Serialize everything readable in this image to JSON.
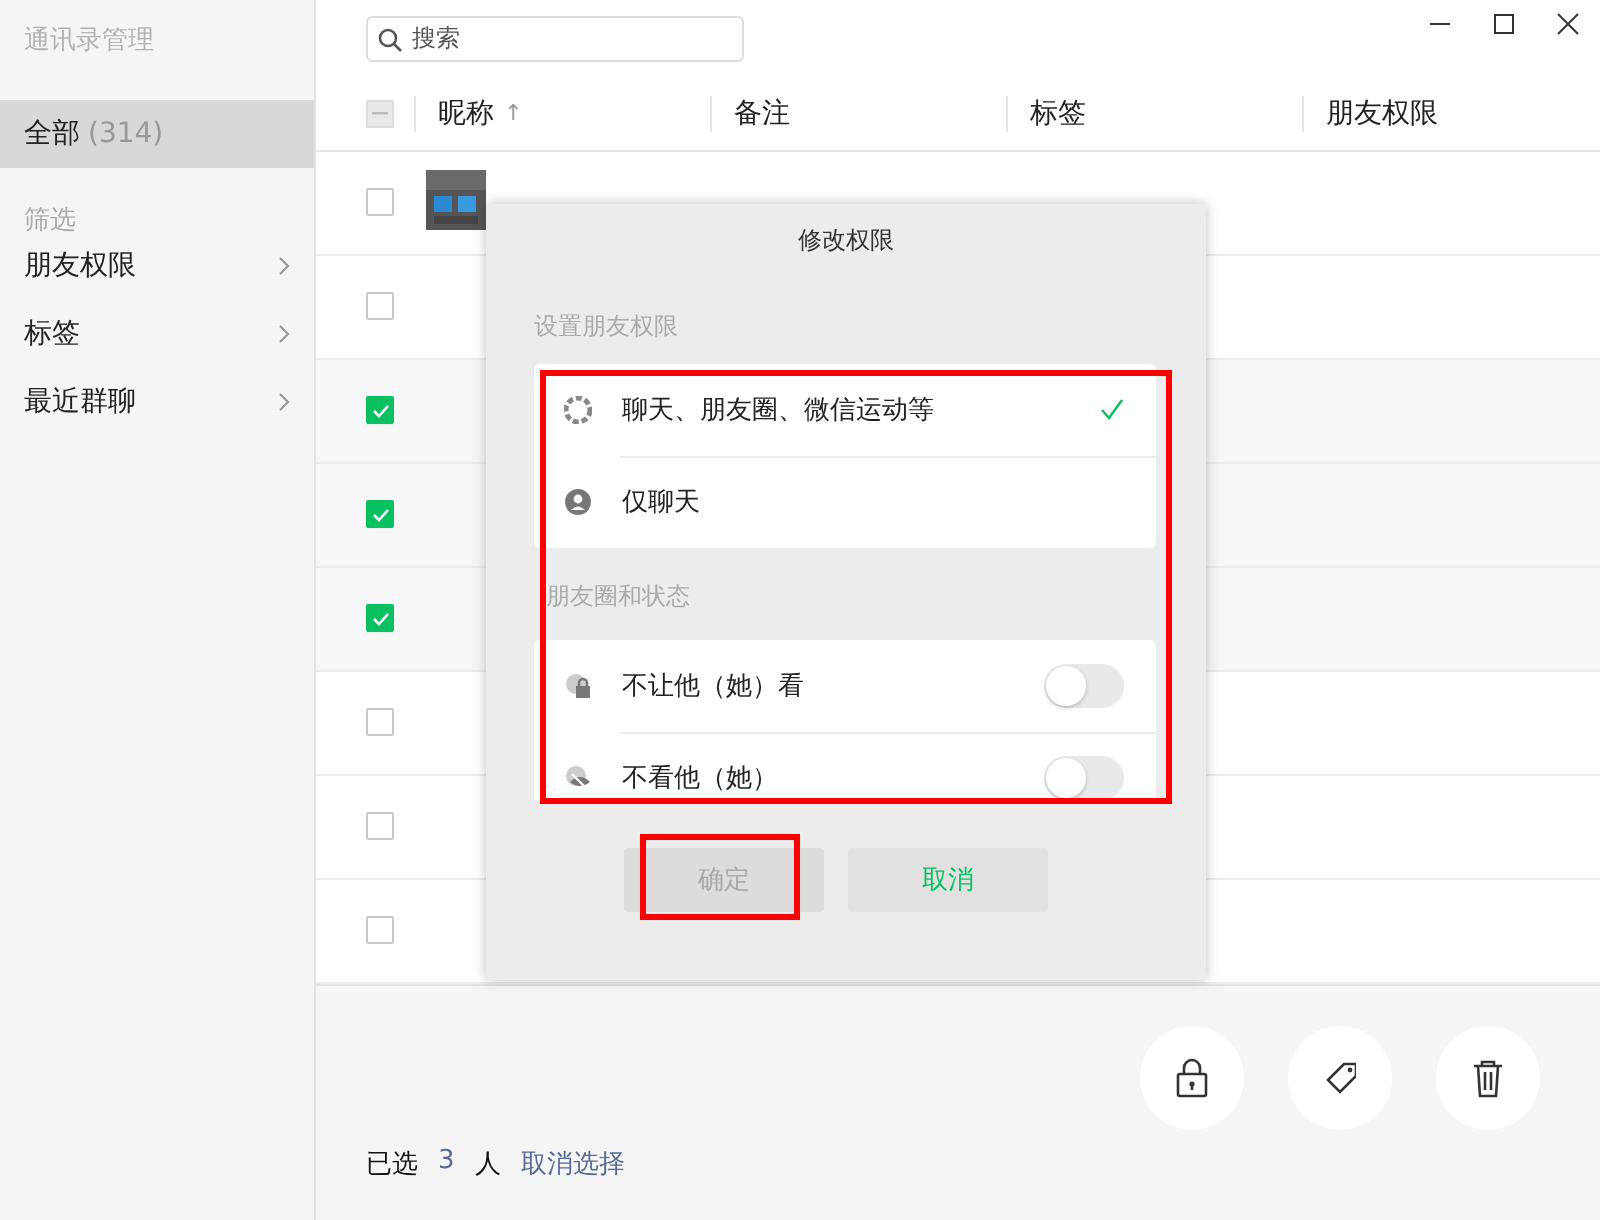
{
  "sidebar": {
    "title": "通讯录管理",
    "all": {
      "label": "全部",
      "count": "(314)",
      "selected": true
    },
    "filter_heading": "筛选",
    "items": [
      {
        "label": "朋友权限"
      },
      {
        "label": "标签"
      },
      {
        "label": "最近群聊"
      }
    ]
  },
  "search": {
    "placeholder": "搜索"
  },
  "table": {
    "select_all_indeterminate": true,
    "columns": [
      {
        "label": "昵称",
        "sort_indicator": "↑"
      },
      {
        "label": "备注"
      },
      {
        "label": "标签"
      },
      {
        "label": "朋友权限"
      }
    ],
    "rows": [
      {
        "checked": false,
        "avatar": true
      },
      {
        "checked": false
      },
      {
        "checked": true
      },
      {
        "checked": true
      },
      {
        "checked": true
      },
      {
        "checked": false
      },
      {
        "checked": false
      },
      {
        "checked": false
      }
    ]
  },
  "dialog": {
    "title": "修改权限",
    "highlighted": true,
    "sections": [
      {
        "heading": "设置朋友权限",
        "options": [
          {
            "kind": "radio",
            "label": "聊天、朋友圈、微信运动等",
            "selected": true
          },
          {
            "kind": "radio",
            "label": "仅聊天",
            "selected": false
          }
        ]
      },
      {
        "heading": "朋友圈和状态",
        "options": [
          {
            "kind": "toggle",
            "label": "不让他（她）看",
            "on": false
          },
          {
            "kind": "toggle",
            "label": "不看他（她）",
            "on": false
          }
        ]
      }
    ],
    "buttons": [
      {
        "label": "确定",
        "disabled": true,
        "highlighted": true
      },
      {
        "label": "取消",
        "disabled": false,
        "highlighted": false
      }
    ]
  },
  "footer": {
    "selected_prefix": "已选",
    "selected_count": "3",
    "selected_suffix": "人",
    "clear_link": "取消选择"
  }
}
